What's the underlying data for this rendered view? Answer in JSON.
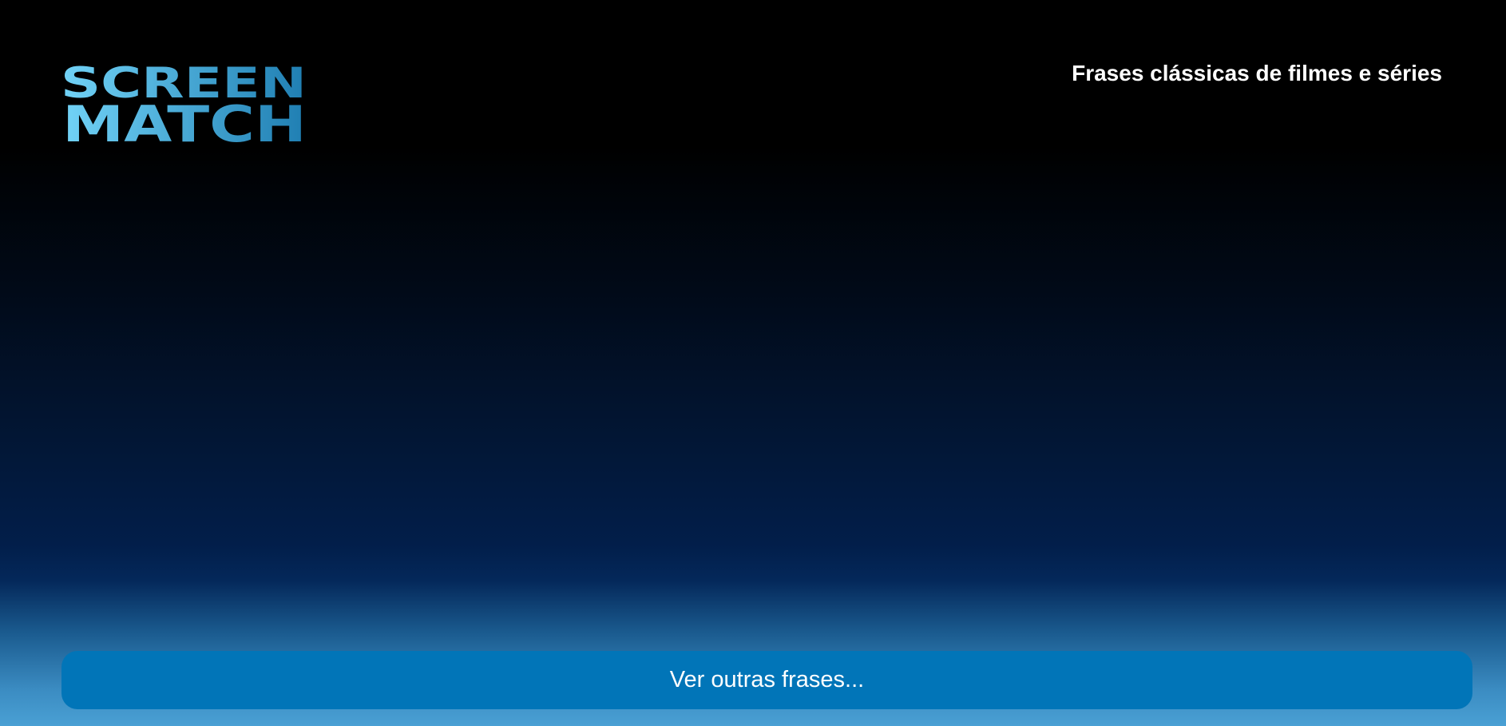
{
  "header": {
    "logo": {
      "line1": "SCREEN",
      "line2": "MATCH"
    },
    "tagline": "Frases clássicas de filmes e séries"
  },
  "main": {
    "more_phrases_button_label": "Ver outras frases..."
  },
  "colors": {
    "background_top": "#000000",
    "background_mid": "#021e4a",
    "background_bottom": "#4aa0d4",
    "button": "#0175b8",
    "logo_gradient_start": "#6fd0f5",
    "logo_gradient_end": "#1f7fb3",
    "text": "#ffffff"
  }
}
